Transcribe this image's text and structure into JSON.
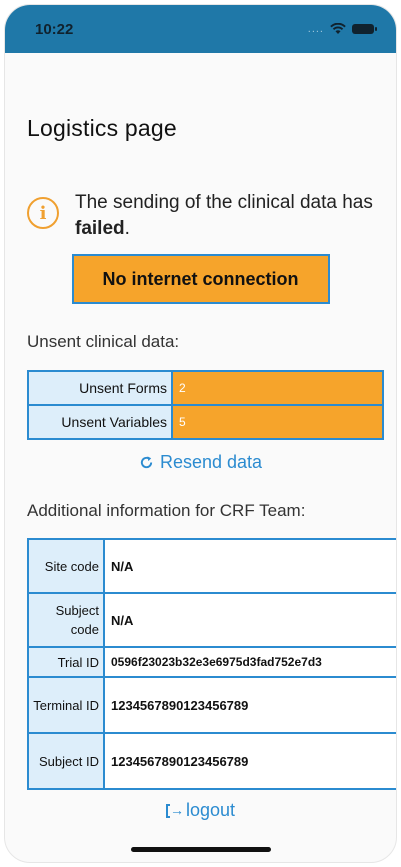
{
  "status": {
    "time": "10:22",
    "signal": "....",
    "wifi_icon": "wifi-icon",
    "battery_icon": "battery-icon"
  },
  "page": {
    "title": "Logistics page"
  },
  "alert": {
    "icon": "info-icon",
    "text_prefix": "The sending of the clinical data has ",
    "text_bold": "failed",
    "text_suffix": ".",
    "no_connection": "No internet connection"
  },
  "unsent": {
    "label": "Unsent clinical data:",
    "rows": [
      {
        "key": "Unsent Forms",
        "value": "2"
      },
      {
        "key": "Unsent Variables",
        "value": "5"
      }
    ]
  },
  "resend": {
    "label": "Resend data",
    "icon": "refresh-icon"
  },
  "additional": {
    "label": "Additional information for CRF Team:",
    "rows": [
      {
        "key": "Site code",
        "value": "N/A"
      },
      {
        "key": "Subject code",
        "value": "N/A"
      },
      {
        "key": "Trial ID",
        "value": "0596f23023b32e3e6975d3fad752e7d3"
      },
      {
        "key": "Terminal ID",
        "value": "1234567890123456789"
      },
      {
        "key": "Subject ID",
        "value": "1234567890123456789"
      }
    ]
  },
  "logout": {
    "label": "logout",
    "icon": "logout-icon"
  },
  "colors": {
    "accent": "#2b8bd0",
    "warning": "#f6a42b",
    "header": "#1f78a8",
    "cell_bg": "#ddeefa"
  }
}
